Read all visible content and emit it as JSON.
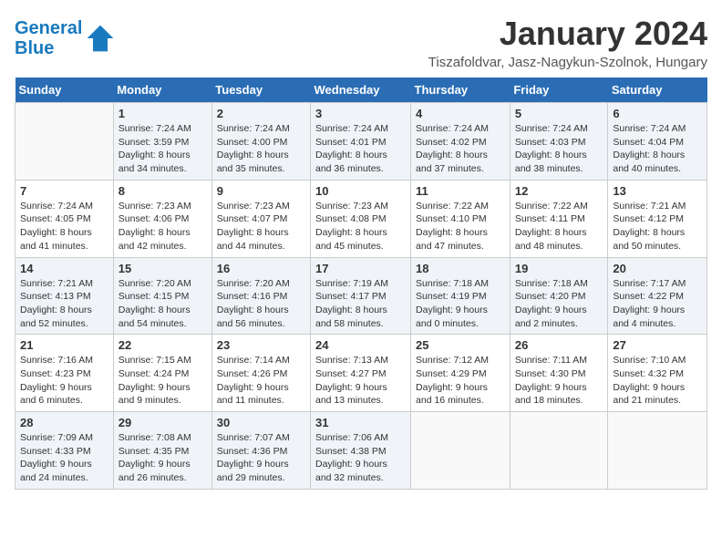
{
  "logo": {
    "line1": "General",
    "line2": "Blue"
  },
  "title": "January 2024",
  "location": "Tiszafoldvar, Jasz-Nagykun-Szolnok, Hungary",
  "days_of_week": [
    "Sunday",
    "Monday",
    "Tuesday",
    "Wednesday",
    "Thursday",
    "Friday",
    "Saturday"
  ],
  "weeks": [
    [
      {
        "day": "",
        "sunrise": "",
        "sunset": "",
        "daylight": ""
      },
      {
        "day": "1",
        "sunrise": "Sunrise: 7:24 AM",
        "sunset": "Sunset: 3:59 PM",
        "daylight": "Daylight: 8 hours and 34 minutes."
      },
      {
        "day": "2",
        "sunrise": "Sunrise: 7:24 AM",
        "sunset": "Sunset: 4:00 PM",
        "daylight": "Daylight: 8 hours and 35 minutes."
      },
      {
        "day": "3",
        "sunrise": "Sunrise: 7:24 AM",
        "sunset": "Sunset: 4:01 PM",
        "daylight": "Daylight: 8 hours and 36 minutes."
      },
      {
        "day": "4",
        "sunrise": "Sunrise: 7:24 AM",
        "sunset": "Sunset: 4:02 PM",
        "daylight": "Daylight: 8 hours and 37 minutes."
      },
      {
        "day": "5",
        "sunrise": "Sunrise: 7:24 AM",
        "sunset": "Sunset: 4:03 PM",
        "daylight": "Daylight: 8 hours and 38 minutes."
      },
      {
        "day": "6",
        "sunrise": "Sunrise: 7:24 AM",
        "sunset": "Sunset: 4:04 PM",
        "daylight": "Daylight: 8 hours and 40 minutes."
      }
    ],
    [
      {
        "day": "7",
        "sunrise": "Sunrise: 7:24 AM",
        "sunset": "Sunset: 4:05 PM",
        "daylight": "Daylight: 8 hours and 41 minutes."
      },
      {
        "day": "8",
        "sunrise": "Sunrise: 7:23 AM",
        "sunset": "Sunset: 4:06 PM",
        "daylight": "Daylight: 8 hours and 42 minutes."
      },
      {
        "day": "9",
        "sunrise": "Sunrise: 7:23 AM",
        "sunset": "Sunset: 4:07 PM",
        "daylight": "Daylight: 8 hours and 44 minutes."
      },
      {
        "day": "10",
        "sunrise": "Sunrise: 7:23 AM",
        "sunset": "Sunset: 4:08 PM",
        "daylight": "Daylight: 8 hours and 45 minutes."
      },
      {
        "day": "11",
        "sunrise": "Sunrise: 7:22 AM",
        "sunset": "Sunset: 4:10 PM",
        "daylight": "Daylight: 8 hours and 47 minutes."
      },
      {
        "day": "12",
        "sunrise": "Sunrise: 7:22 AM",
        "sunset": "Sunset: 4:11 PM",
        "daylight": "Daylight: 8 hours and 48 minutes."
      },
      {
        "day": "13",
        "sunrise": "Sunrise: 7:21 AM",
        "sunset": "Sunset: 4:12 PM",
        "daylight": "Daylight: 8 hours and 50 minutes."
      }
    ],
    [
      {
        "day": "14",
        "sunrise": "Sunrise: 7:21 AM",
        "sunset": "Sunset: 4:13 PM",
        "daylight": "Daylight: 8 hours and 52 minutes."
      },
      {
        "day": "15",
        "sunrise": "Sunrise: 7:20 AM",
        "sunset": "Sunset: 4:15 PM",
        "daylight": "Daylight: 8 hours and 54 minutes."
      },
      {
        "day": "16",
        "sunrise": "Sunrise: 7:20 AM",
        "sunset": "Sunset: 4:16 PM",
        "daylight": "Daylight: 8 hours and 56 minutes."
      },
      {
        "day": "17",
        "sunrise": "Sunrise: 7:19 AM",
        "sunset": "Sunset: 4:17 PM",
        "daylight": "Daylight: 8 hours and 58 minutes."
      },
      {
        "day": "18",
        "sunrise": "Sunrise: 7:18 AM",
        "sunset": "Sunset: 4:19 PM",
        "daylight": "Daylight: 9 hours and 0 minutes."
      },
      {
        "day": "19",
        "sunrise": "Sunrise: 7:18 AM",
        "sunset": "Sunset: 4:20 PM",
        "daylight": "Daylight: 9 hours and 2 minutes."
      },
      {
        "day": "20",
        "sunrise": "Sunrise: 7:17 AM",
        "sunset": "Sunset: 4:22 PM",
        "daylight": "Daylight: 9 hours and 4 minutes."
      }
    ],
    [
      {
        "day": "21",
        "sunrise": "Sunrise: 7:16 AM",
        "sunset": "Sunset: 4:23 PM",
        "daylight": "Daylight: 9 hours and 6 minutes."
      },
      {
        "day": "22",
        "sunrise": "Sunrise: 7:15 AM",
        "sunset": "Sunset: 4:24 PM",
        "daylight": "Daylight: 9 hours and 9 minutes."
      },
      {
        "day": "23",
        "sunrise": "Sunrise: 7:14 AM",
        "sunset": "Sunset: 4:26 PM",
        "daylight": "Daylight: 9 hours and 11 minutes."
      },
      {
        "day": "24",
        "sunrise": "Sunrise: 7:13 AM",
        "sunset": "Sunset: 4:27 PM",
        "daylight": "Daylight: 9 hours and 13 minutes."
      },
      {
        "day": "25",
        "sunrise": "Sunrise: 7:12 AM",
        "sunset": "Sunset: 4:29 PM",
        "daylight": "Daylight: 9 hours and 16 minutes."
      },
      {
        "day": "26",
        "sunrise": "Sunrise: 7:11 AM",
        "sunset": "Sunset: 4:30 PM",
        "daylight": "Daylight: 9 hours and 18 minutes."
      },
      {
        "day": "27",
        "sunrise": "Sunrise: 7:10 AM",
        "sunset": "Sunset: 4:32 PM",
        "daylight": "Daylight: 9 hours and 21 minutes."
      }
    ],
    [
      {
        "day": "28",
        "sunrise": "Sunrise: 7:09 AM",
        "sunset": "Sunset: 4:33 PM",
        "daylight": "Daylight: 9 hours and 24 minutes."
      },
      {
        "day": "29",
        "sunrise": "Sunrise: 7:08 AM",
        "sunset": "Sunset: 4:35 PM",
        "daylight": "Daylight: 9 hours and 26 minutes."
      },
      {
        "day": "30",
        "sunrise": "Sunrise: 7:07 AM",
        "sunset": "Sunset: 4:36 PM",
        "daylight": "Daylight: 9 hours and 29 minutes."
      },
      {
        "day": "31",
        "sunrise": "Sunrise: 7:06 AM",
        "sunset": "Sunset: 4:38 PM",
        "daylight": "Daylight: 9 hours and 32 minutes."
      },
      {
        "day": "",
        "sunrise": "",
        "sunset": "",
        "daylight": ""
      },
      {
        "day": "",
        "sunrise": "",
        "sunset": "",
        "daylight": ""
      },
      {
        "day": "",
        "sunrise": "",
        "sunset": "",
        "daylight": ""
      }
    ]
  ]
}
